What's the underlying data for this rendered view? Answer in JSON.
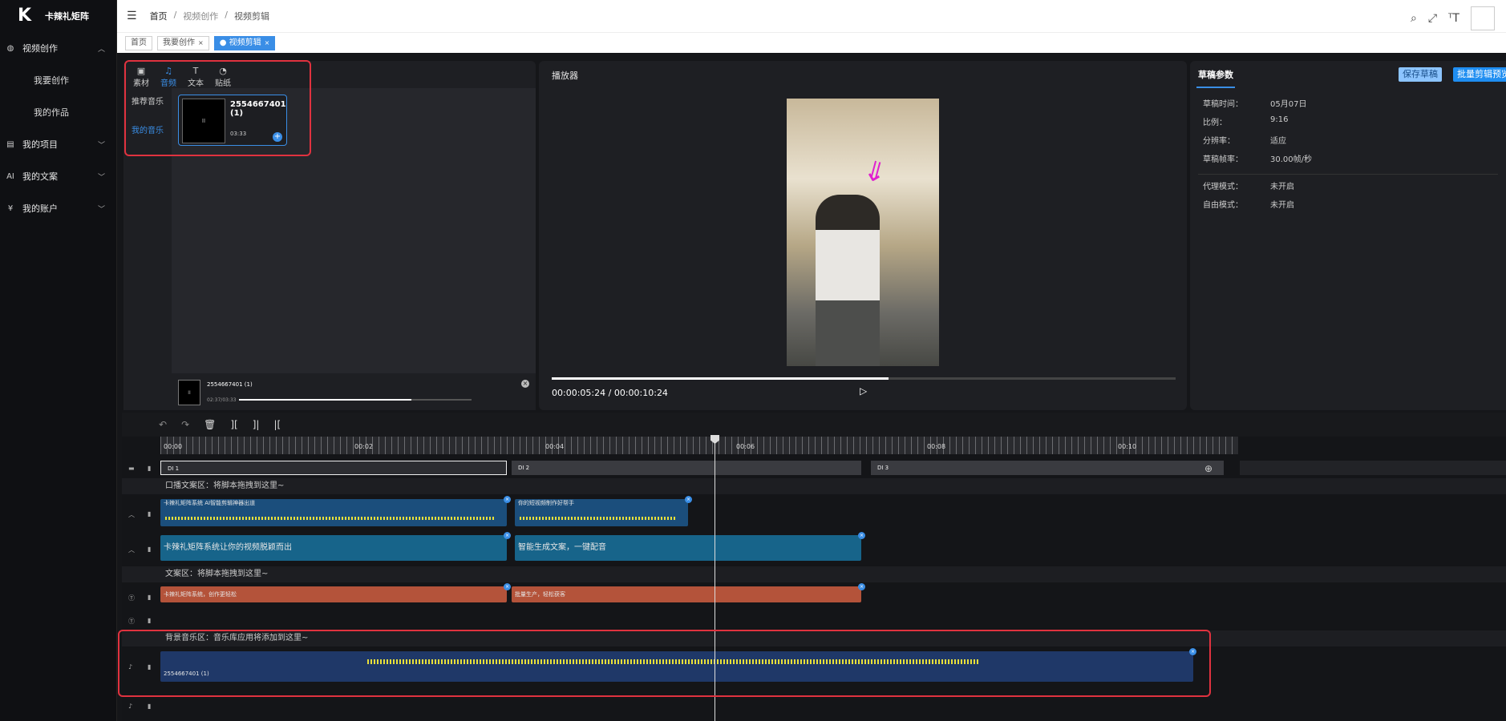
{
  "app": {
    "name": "卡辣礼矩阵"
  },
  "sidebar": {
    "groups": [
      {
        "label": "视频创作",
        "icon": "globe-icon",
        "open": true,
        "items": [
          "我要创作",
          "我的作品"
        ]
      },
      {
        "label": "我的项目",
        "icon": "document-icon"
      },
      {
        "label": "我的文案",
        "icon": "ai-icon"
      },
      {
        "label": "我的账户",
        "icon": "yen-icon"
      }
    ]
  },
  "topbar": {
    "breadcrumb": [
      "首页",
      "视频创作",
      "视频剪辑"
    ]
  },
  "tags": [
    {
      "label": "首页"
    },
    {
      "label": "我要创作"
    },
    {
      "label": "视频剪辑",
      "active": true
    }
  ],
  "materials": {
    "tabs": [
      {
        "label": "素材",
        "icon": "play-square-icon"
      },
      {
        "label": "音频",
        "icon": "music-icon",
        "active": true
      },
      {
        "label": "文本",
        "icon": "text-icon"
      },
      {
        "label": "贴纸",
        "icon": "sticker-icon"
      }
    ],
    "side": [
      "推荐音乐",
      "我的音乐"
    ],
    "card": {
      "title": "2554667401 (1)",
      "duration": "03:33",
      "thumb": "II"
    },
    "mini_player": {
      "title": "2554667401 (1)",
      "time": "02:37/03:33",
      "progress": 0.74,
      "thumb": "II"
    }
  },
  "player": {
    "title": "播放器",
    "current": "00:00:05:24",
    "separator": "/",
    "total": "00:00:10:24",
    "progress": 0.54
  },
  "params": {
    "tab": "草稿参数",
    "save": "保存草稿",
    "batch": "批量剪辑预览",
    "rows": [
      {
        "k": "草稿时间：",
        "v": "05月07日"
      },
      {
        "k": "比例：",
        "v": "9:16"
      },
      {
        "k": "分辨率：",
        "v": "适应"
      },
      {
        "k": "草稿帧率：",
        "v": "30.00帧/秒"
      },
      {
        "k": "代理模式：",
        "v": "未开启"
      },
      {
        "k": "自由模式：",
        "v": "未开启"
      }
    ]
  },
  "timeline": {
    "ruler": [
      "00:00",
      "00:02",
      "00:04",
      "00:06",
      "00:08",
      "00:10"
    ],
    "video_clips": [
      "DI 1",
      "DI 2",
      "DI 3"
    ],
    "zones": {
      "voice": "口播文案区：将脚本拖拽到这里~",
      "text": "文案区：将脚本拖拽到这里~",
      "music": "背景音乐区：音乐库应用将添加到这里~"
    },
    "voice_clips": [
      "卡辣礼矩阵系统 AI智能剪辑神器出道",
      "你的短视频制作好帮手"
    ],
    "subtitle_clips": [
      "卡辣礼矩阵系统让你的视频脱颖而出",
      "智能生成文案，一键配音"
    ],
    "text_clips": [
      "卡辣礼矩阵系统，创作更轻松",
      "批量生产，轻松获客"
    ],
    "music_clip": "2554667401 (1)"
  }
}
